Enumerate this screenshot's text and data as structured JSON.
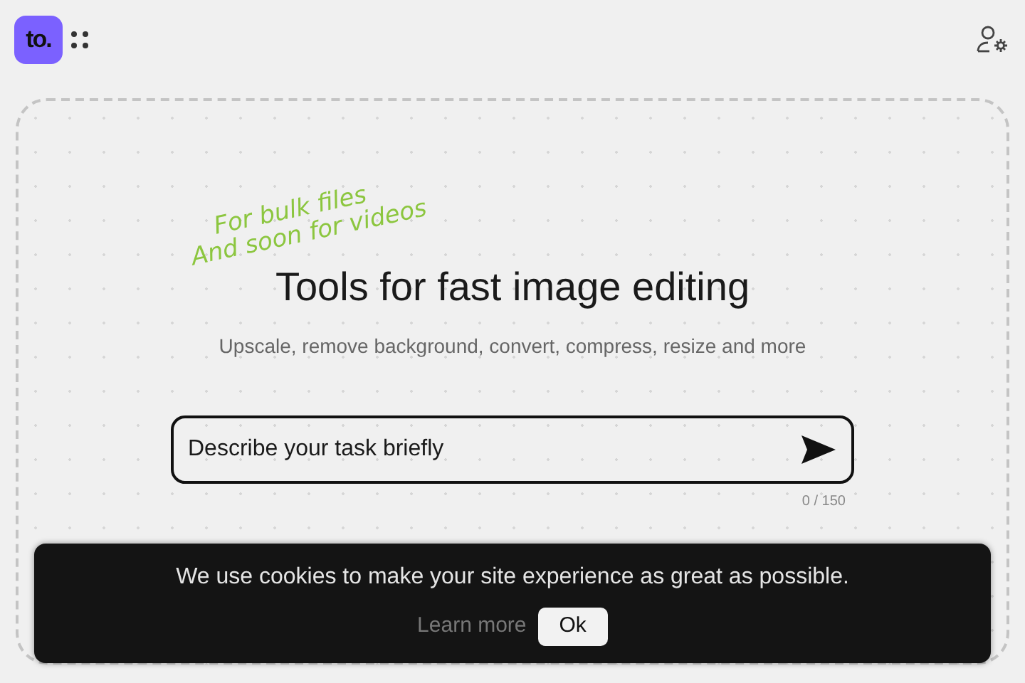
{
  "header": {
    "logo": "to."
  },
  "annotation": [
    "For bulk files",
    "And soon for videos"
  ],
  "hero": {
    "title": "Tools for fast image editing",
    "subtitle": "Upscale, remove background, convert, compress, resize and more"
  },
  "task_input": {
    "placeholder": "Describe your task briefly",
    "counter": "0 / 150"
  },
  "cookie_banner": {
    "message": "We use cookies to make your site experience as great as possible.",
    "learn_more": "Learn more",
    "ok": "Ok"
  }
}
